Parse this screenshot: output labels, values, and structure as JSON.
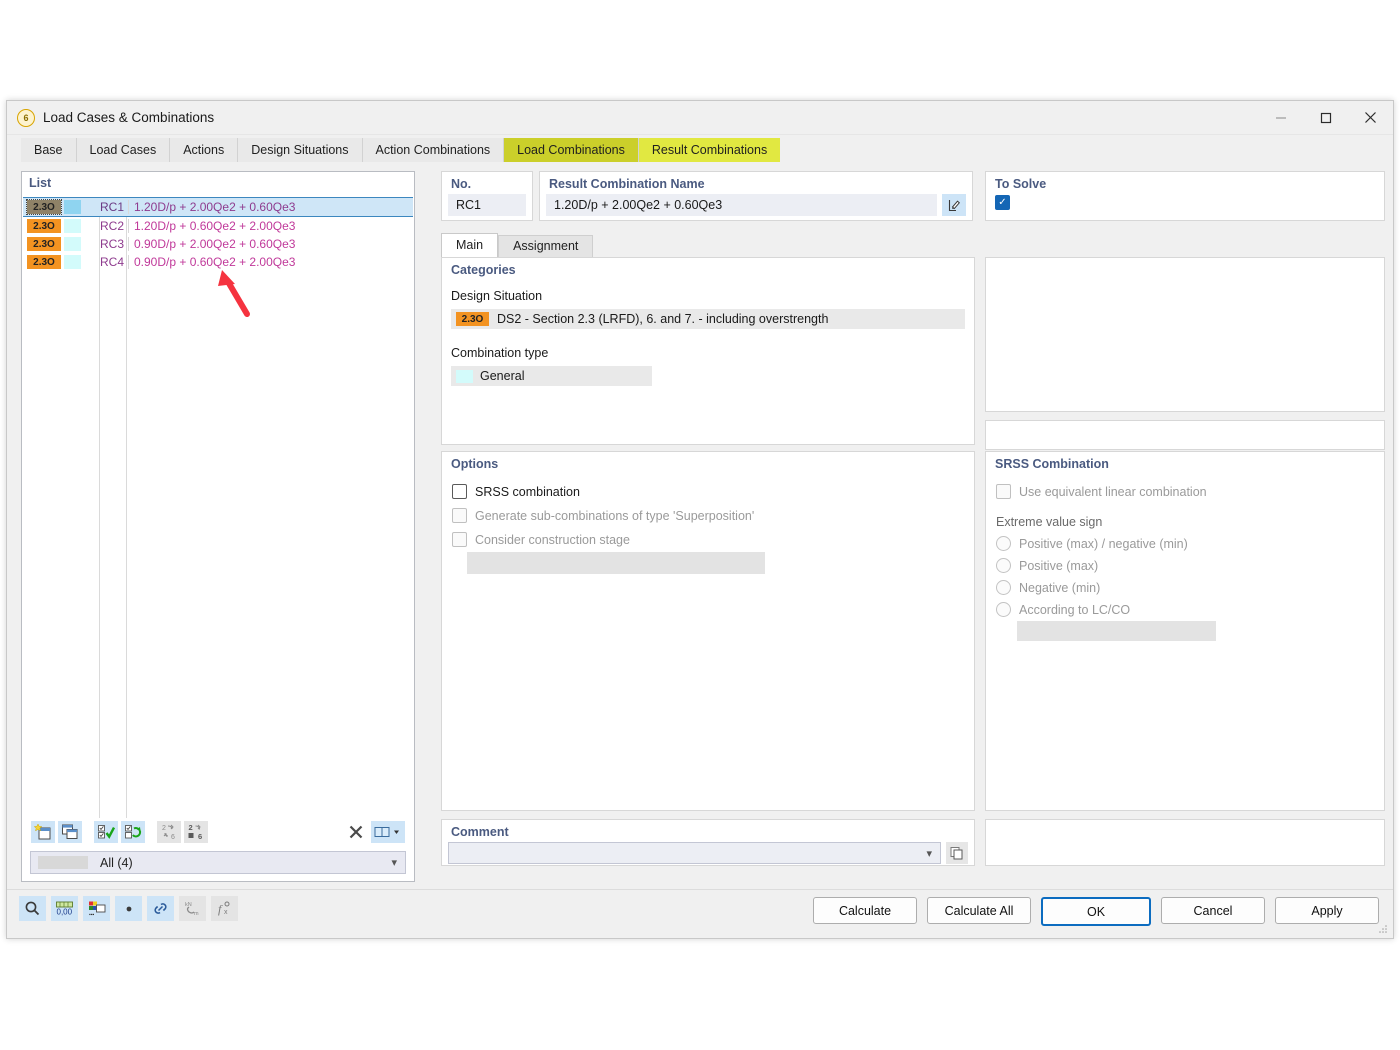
{
  "window": {
    "title": "Load Cases & Combinations",
    "icon": "app-icon",
    "controls": {
      "minimize": "–",
      "maximize": "▢",
      "close": "✕"
    }
  },
  "tabs": [
    {
      "label": "Base",
      "state": "normal"
    },
    {
      "label": "Load Cases",
      "state": "normal"
    },
    {
      "label": "Actions",
      "state": "normal"
    },
    {
      "label": "Design Situations",
      "state": "normal"
    },
    {
      "label": "Action Combinations",
      "state": "normal"
    },
    {
      "label": "Load Combinations",
      "state": "highlight"
    },
    {
      "label": "Result Combinations",
      "state": "active-highlight"
    }
  ],
  "list": {
    "header": "List",
    "rows": [
      {
        "badge": "2.3O",
        "no": "RC1",
        "description": "1.20D/p + 2.00Qe2 + 0.60Qe3",
        "selected": true
      },
      {
        "badge": "2.3O",
        "no": "RC2",
        "description": "1.20D/p + 0.60Qe2 + 2.00Qe3",
        "selected": false
      },
      {
        "badge": "2.3O",
        "no": "RC3",
        "description": "0.90D/p + 2.00Qe2 + 0.60Qe3",
        "selected": false
      },
      {
        "badge": "2.3O",
        "no": "RC4",
        "description": "0.90D/p + 0.60Qe2 + 2.00Qe3",
        "selected": false
      }
    ],
    "toolbar": [
      {
        "name": "new-item-button",
        "enabled": true
      },
      {
        "name": "copy-item-button",
        "enabled": true
      },
      {
        "name": "select-all-button",
        "enabled": true
      },
      {
        "name": "invert-selection-button",
        "enabled": true
      },
      {
        "name": "renumber-button",
        "enabled": false
      },
      {
        "name": "renumber-partial-button",
        "enabled": false
      },
      {
        "name": "delete-button",
        "enabled": true
      },
      {
        "name": "view-layout-button",
        "enabled": true
      }
    ],
    "filter": "All (4)"
  },
  "details": {
    "no_label": "No.",
    "no_value": "RC1",
    "name_label": "Result Combination Name",
    "name_value": "1.20D/p + 2.00Qe2 + 0.60Qe3",
    "edit_button": "edit-name-button",
    "to_solve_label": "To Solve",
    "to_solve_checked": true,
    "inner_tabs": [
      {
        "label": "Main",
        "active": true
      },
      {
        "label": "Assignment",
        "active": false
      }
    ],
    "categories": {
      "title": "Categories",
      "design_situation_label": "Design Situation",
      "design_situation_badge": "2.3O",
      "design_situation_value": "DS2 - Section 2.3 (LRFD), 6. and 7. - including overstrength",
      "combination_type_label": "Combination type",
      "combination_type_value": "General"
    },
    "options": {
      "title": "Options",
      "items": [
        {
          "label": "SRSS combination",
          "checked": false,
          "enabled": true
        },
        {
          "label": "Generate sub-combinations of type 'Superposition'",
          "checked": false,
          "enabled": false
        },
        {
          "label": "Consider construction stage",
          "checked": false,
          "enabled": false
        }
      ]
    },
    "srss": {
      "title": "SRSS Combination",
      "use_equivalent_label": "Use equivalent linear combination",
      "use_equivalent_checked": false,
      "extreme_value_label": "Extreme value sign",
      "radios": [
        {
          "label": "Positive (max) / negative (min)",
          "selected": false
        },
        {
          "label": "Positive (max)",
          "selected": false
        },
        {
          "label": "Negative (min)",
          "selected": false
        },
        {
          "label": "According to LC/CO",
          "selected": false
        }
      ]
    },
    "comment": {
      "title": "Comment",
      "value": "",
      "copy_button": "comment-copy-button"
    }
  },
  "footer": {
    "icons": [
      {
        "name": "magnifier-icon",
        "enabled": true
      },
      {
        "name": "numeric-format-icon",
        "enabled": true
      },
      {
        "name": "color-legend-icon",
        "enabled": true
      },
      {
        "name": "dot-icon",
        "enabled": true
      },
      {
        "name": "link-icon",
        "enabled": true
      },
      {
        "name": "units-icon",
        "enabled": false
      },
      {
        "name": "function-icon",
        "enabled": false
      }
    ],
    "buttons": [
      {
        "label": "Calculate",
        "primary": false
      },
      {
        "label": "Calculate All",
        "primary": false
      },
      {
        "label": "OK",
        "primary": true
      },
      {
        "label": "Cancel",
        "primary": false
      },
      {
        "label": "Apply",
        "primary": false
      }
    ]
  },
  "annotation": {
    "type": "arrow",
    "color": "#f5333f"
  },
  "colors": {
    "tab_highlight_a": "#cbcf2a",
    "tab_highlight_b": "#e1e841",
    "badge_orange": "#f39321",
    "selection_blue": "#cfe6f7",
    "section_title": "#4a5a80",
    "row_magenta": "#c0399a",
    "accent_blue": "#1466b5"
  }
}
